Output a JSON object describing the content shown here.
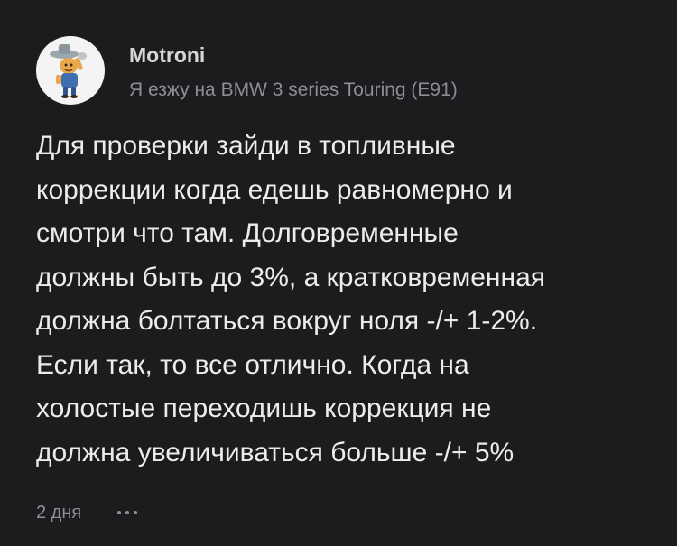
{
  "comment": {
    "author": "Motroni",
    "car": "Я езжу на BMW 3 series Touring (E91)",
    "body_lines": [
      "Для проверки зайди в топливные",
      "коррекции когда едешь равномерно и",
      "смотри что там. Долговременные",
      "должны быть до 3%, а кратковременная",
      "должна болтаться вокруг ноля -/+ 1-2%.",
      "Если так, то все отлично. Когда на",
      "холостые переходишь коррекция не",
      "должна увеличиваться больше -/+ 5%"
    ],
    "time": "2 дня",
    "avatar_icon": "cartoon-character-avatar",
    "more_icon": "more-dots-icon"
  },
  "colors": {
    "background": "#1c1c1e",
    "text": "#ececee",
    "secondary": "#8d8d92"
  }
}
